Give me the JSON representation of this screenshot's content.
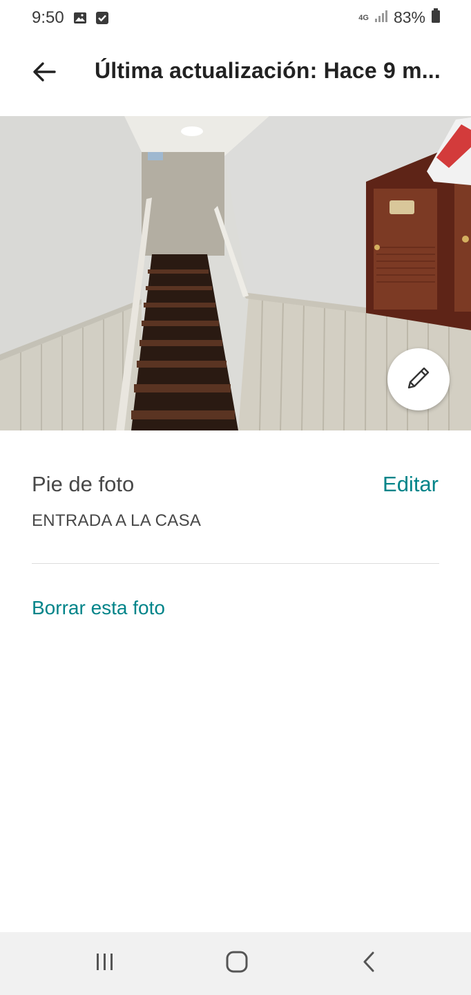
{
  "status_bar": {
    "time": "9:50",
    "network": "4G",
    "battery": "83%",
    "icons": [
      "gallery-icon",
      "check-icon",
      "signal-icon",
      "battery-icon"
    ]
  },
  "app_bar": {
    "title": "Última actualización: Hace 9 m...",
    "back_icon": "arrow-left-icon"
  },
  "photo": {
    "description_icon": "pencil-icon"
  },
  "caption": {
    "heading": "Pie de foto",
    "edit_label": "Editar",
    "value": "ENTRADA A LA CASA"
  },
  "actions": {
    "delete_label": "Borrar esta foto"
  },
  "nav_bar": {
    "icons": [
      "recent-apps-icon",
      "home-icon",
      "back-icon"
    ]
  },
  "colors": {
    "accent": "#008489",
    "text": "#484848",
    "nav_background": "#f1f1f1"
  }
}
